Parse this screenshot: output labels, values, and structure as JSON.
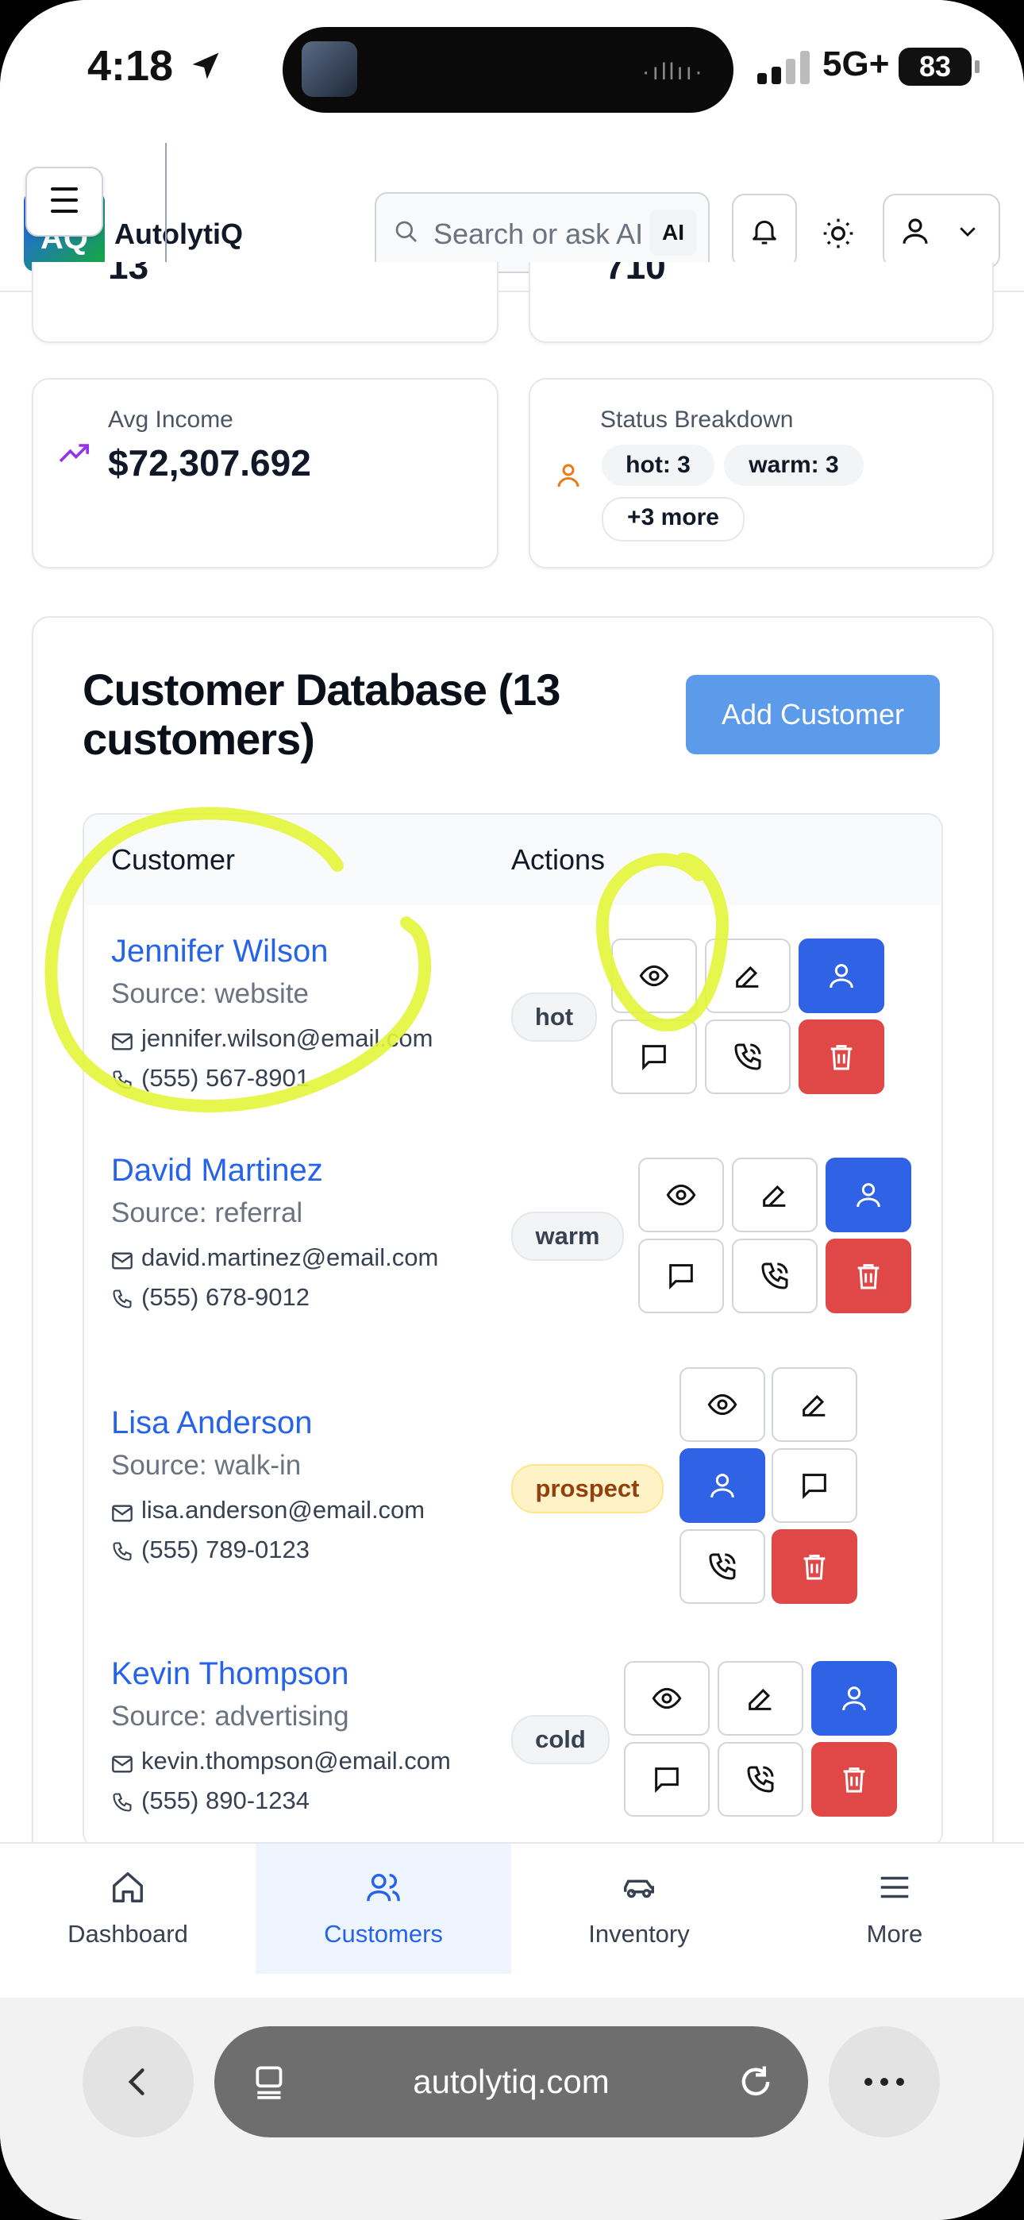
{
  "status_bar": {
    "time": "4:18",
    "network": "5G+",
    "battery": "83"
  },
  "header": {
    "logo_text": "AQ",
    "brand": "AutolytiQ",
    "search_placeholder": "Search or ask AI",
    "search_ai_badge": "AI"
  },
  "stats": {
    "partial_left_value": "13",
    "partial_right_value": "710",
    "avg_income_label": "Avg Income",
    "avg_income_value": "$72,307.692",
    "status_label": "Status Breakdown",
    "status_pills": [
      "hot: 3",
      "warm: 3"
    ],
    "status_more": "+3 more"
  },
  "customers": {
    "title": "Customer Database (13 customers)",
    "add_button": "Add Customer",
    "col_customer": "Customer",
    "col_actions": "Actions",
    "rows": [
      {
        "name": "Jennifer Wilson",
        "source": "Source: website",
        "email": "jennifer.wilson@email.com",
        "phone": "(555) 567-8901",
        "status": "hot"
      },
      {
        "name": "David Martinez",
        "source": "Source: referral",
        "email": "david.martinez@email.com",
        "phone": "(555) 678-9012",
        "status": "warm"
      },
      {
        "name": "Lisa Anderson",
        "source": "Source: walk-in",
        "email": "lisa.anderson@email.com",
        "phone": "(555) 789-0123",
        "status": "prospect"
      },
      {
        "name": "Kevin Thompson",
        "source": "Source: advertising",
        "email": "kevin.thompson@email.com",
        "phone": "(555) 890-1234",
        "status": "cold"
      }
    ]
  },
  "bottom_nav": [
    {
      "label": "Dashboard",
      "icon": "home-icon"
    },
    {
      "label": "Customers",
      "icon": "users-icon"
    },
    {
      "label": "Inventory",
      "icon": "car-icon"
    },
    {
      "label": "More",
      "icon": "menu-icon"
    }
  ],
  "browser": {
    "url": "autolytiq.com"
  },
  "colors": {
    "primary": "#2f62e4",
    "danger": "#e04848",
    "link": "#2563eb",
    "add_button": "#5b9bea",
    "highlight": "#e4f53a"
  }
}
